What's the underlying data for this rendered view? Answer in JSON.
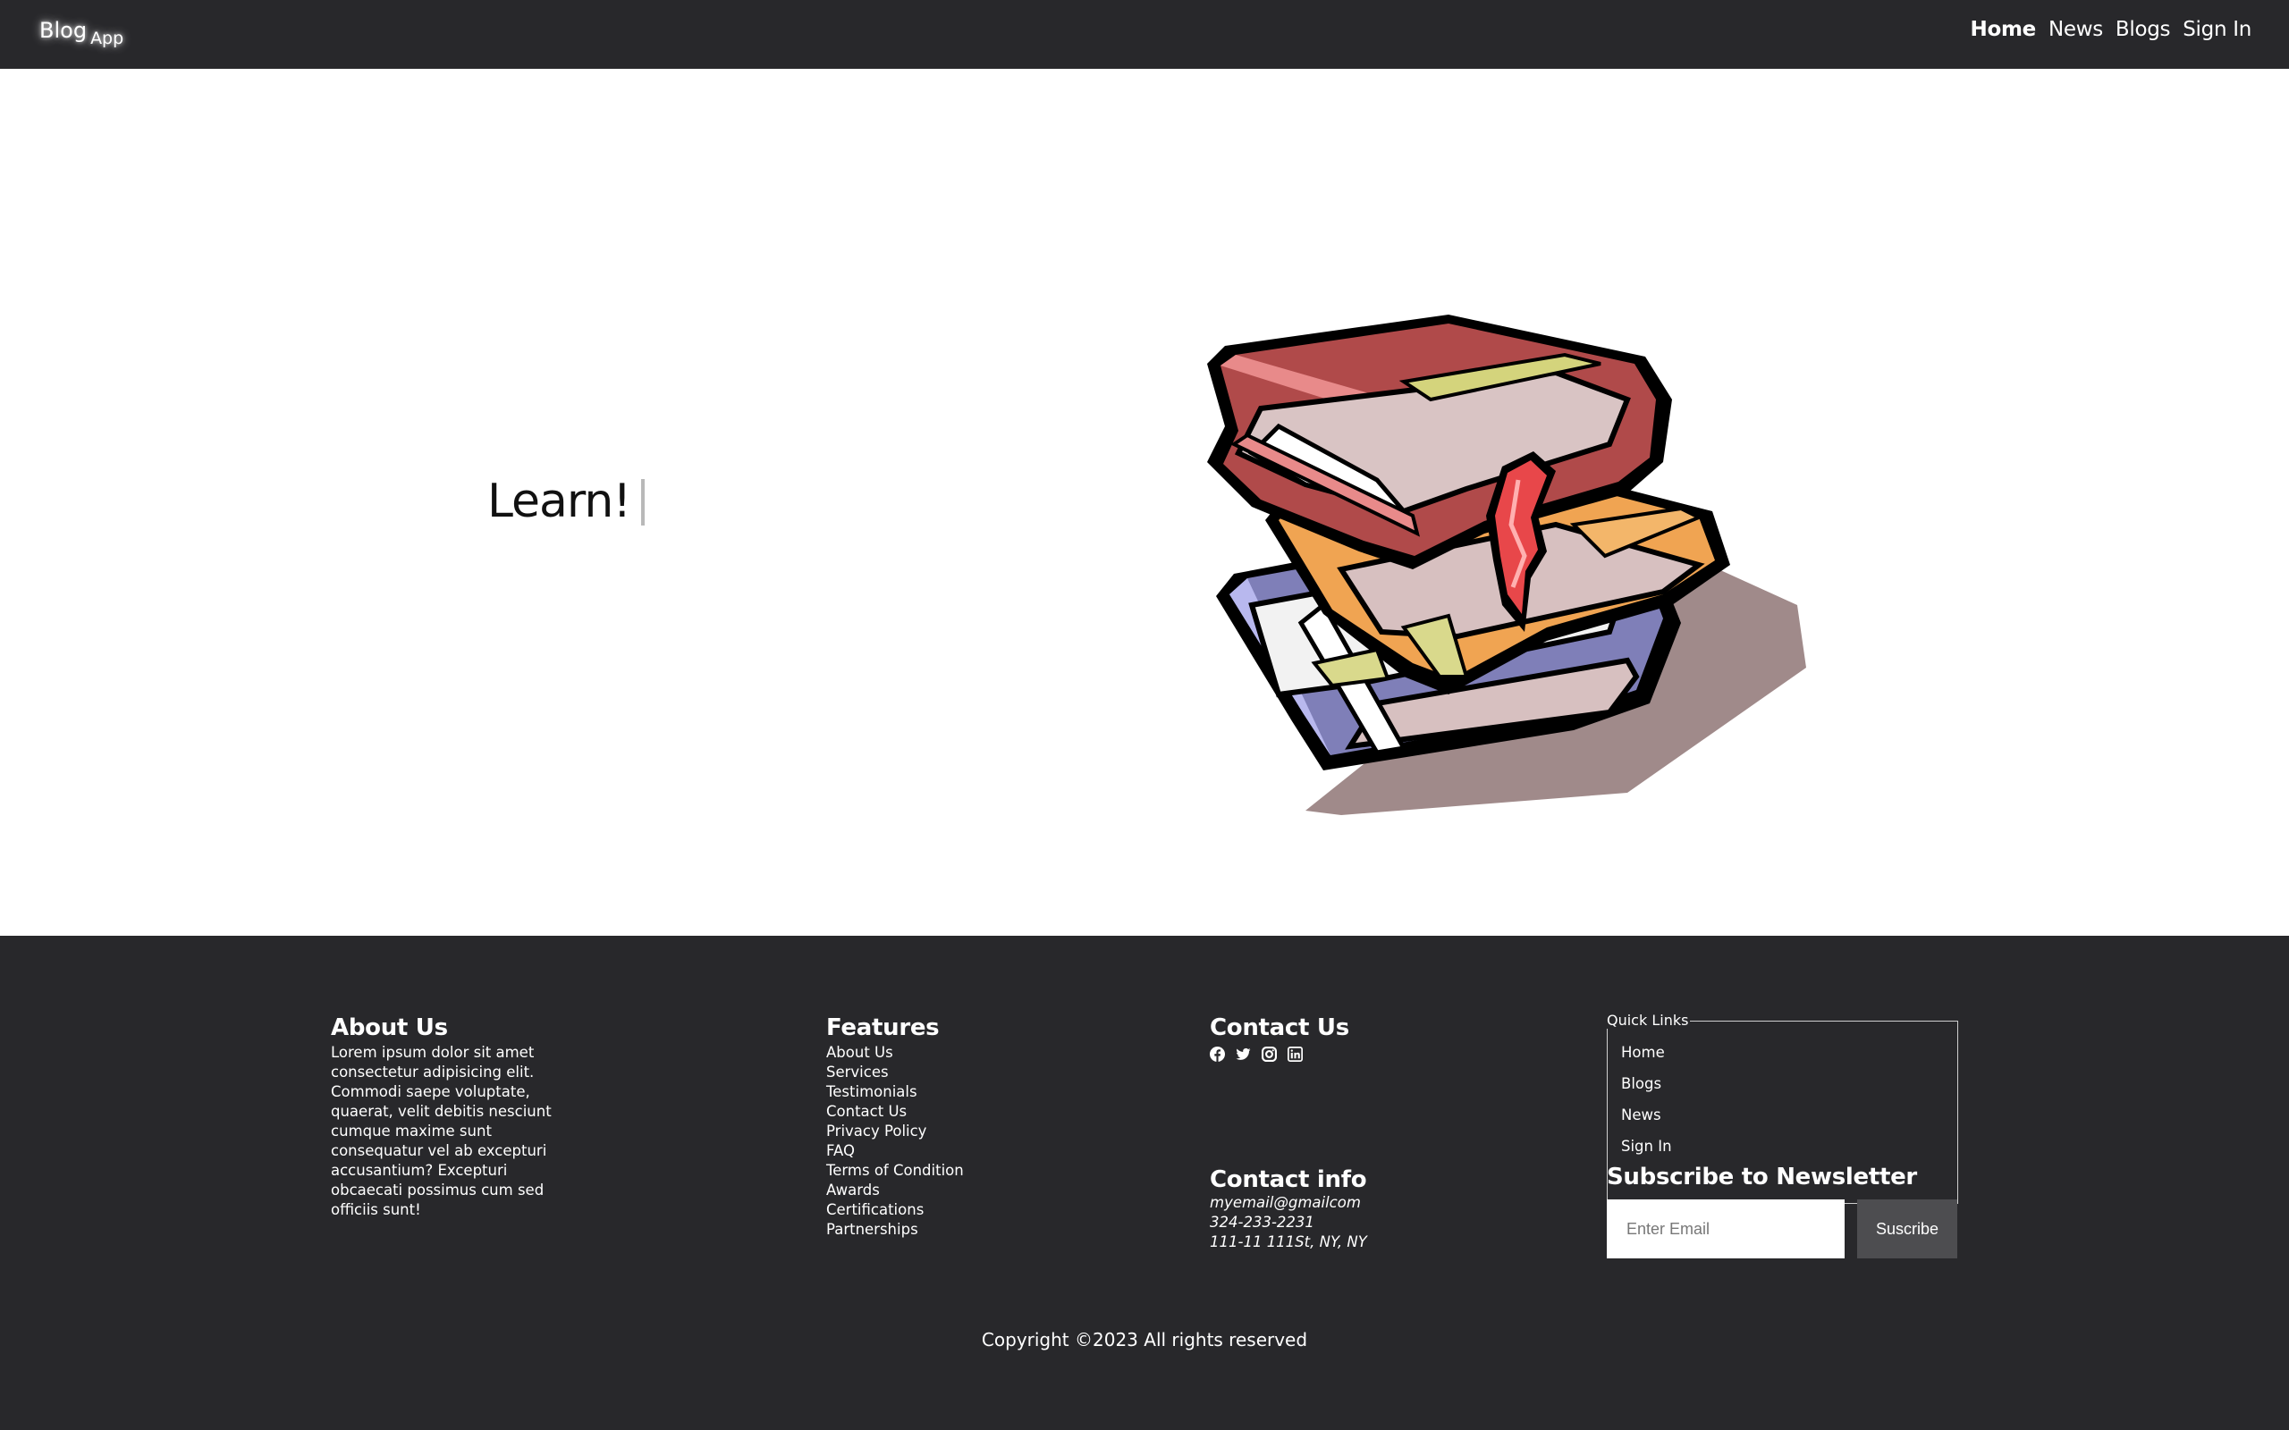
{
  "nav": {
    "brand_main": "Blog",
    "brand_sub": "App",
    "links": [
      "Home",
      "News",
      "Blogs",
      "Sign In"
    ],
    "active": "Home"
  },
  "hero": {
    "headline": "Learn!",
    "illustration": "stack-of-books"
  },
  "footer": {
    "about": {
      "title": "About Us",
      "text": "Lorem ipsum dolor sit amet consectetur adipisicing elit. Commodi saepe voluptate, quaerat, velit debitis nesciunt cumque maxime sunt consequatur vel ab excepturi accusantium? Excepturi obcaecati possimus cum sed officiis sunt!"
    },
    "features": {
      "title": "Features",
      "items": [
        "About Us",
        "Services",
        "Testimonials",
        "Contact Us",
        "Privacy Policy",
        "FAQ",
        "Terms of Condition",
        "Awards",
        "Certifications",
        "Partnerships"
      ]
    },
    "contact_us": {
      "title": "Contact Us",
      "social_icons": [
        "facebook-icon",
        "twitter-icon",
        "instagram-icon",
        "linkedin-icon"
      ]
    },
    "contact_info": {
      "title": "Contact info",
      "email": "myemail@gmailcom",
      "phone": "324-233-2231",
      "address": "111-11 111St, NY, NY"
    },
    "quick_links": {
      "legend": "Quick Links",
      "items": [
        "Home",
        "Blogs",
        "News",
        "Sign In"
      ]
    },
    "newsletter": {
      "title": "Subscribe to Newsletter",
      "placeholder": "Enter Email",
      "button": "Suscribe"
    },
    "copyright": "Copyright ©2023 All rights reserved"
  },
  "colors": {
    "nav_bg": "#28282b",
    "footer_bg": "#28282b",
    "button_bg": "#4d4d50",
    "text_light": "#ffffff"
  }
}
